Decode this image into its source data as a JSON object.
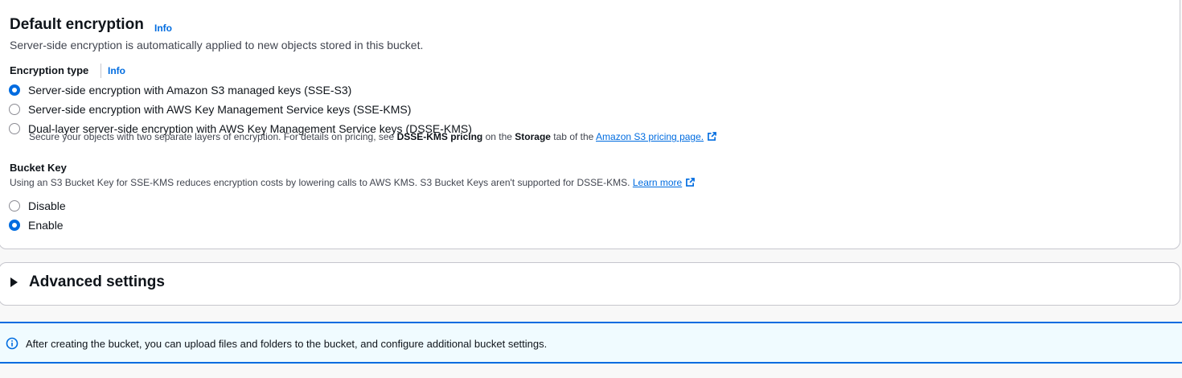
{
  "encryption": {
    "title": "Default encryption",
    "info": "Info",
    "description": "Server-side encryption is automatically applied to new objects stored in this bucket.",
    "type_label": "Encryption type",
    "type_info": "Info",
    "options": [
      {
        "label": "Server-side encryption with Amazon S3 managed keys (SSE-S3)",
        "checked": true
      },
      {
        "label": "Server-side encryption with AWS Key Management Service keys (SSE-KMS)",
        "checked": false
      },
      {
        "label": "Dual-layer server-side encryption with AWS Key Management Service keys (DSSE-KMS)",
        "checked": false
      }
    ],
    "hint": {
      "prefix": "Secure your objects with two separate layers of encryption. For details on pricing, see ",
      "bold1": "DSSE-KMS pricing",
      "middle": " on the ",
      "bold2": "Storage",
      "suffix": " tab of the ",
      "link": "Amazon S3 pricing page."
    }
  },
  "bucket_key": {
    "label": "Bucket Key",
    "description": "Using an S3 Bucket Key for SSE-KMS reduces encryption costs by lowering calls to AWS KMS. S3 Bucket Keys aren't supported for DSSE-KMS. ",
    "learn_more": "Learn more",
    "options": [
      {
        "label": "Disable",
        "checked": false
      },
      {
        "label": "Enable",
        "checked": true
      }
    ]
  },
  "advanced": {
    "title": "Advanced settings",
    "expanded": false
  },
  "flash": {
    "icon": "info-circle-icon",
    "text": "After creating the bucket, you can upload files and folders to the bucket, and configure additional bucket settings."
  },
  "colors": {
    "accent": "#006ce0",
    "info_bg": "#f0fbff"
  }
}
